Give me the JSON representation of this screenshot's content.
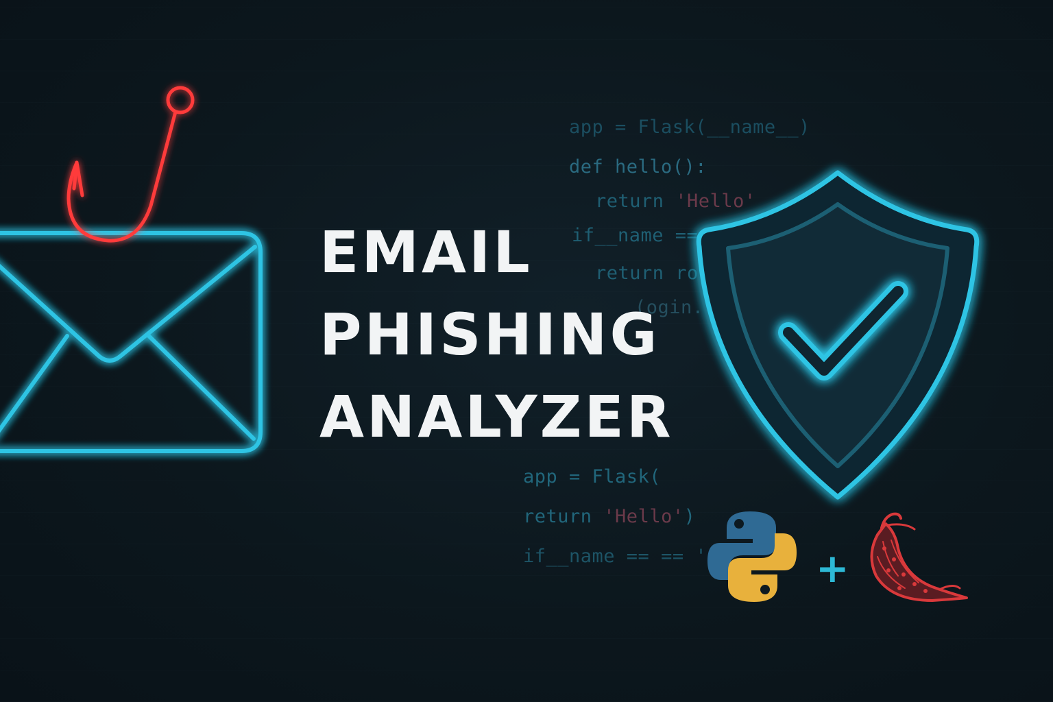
{
  "title": {
    "line1": "EMAIL",
    "line2": "PHISHING",
    "line3": "ANALYZER"
  },
  "code_top": {
    "line1": "app = Flask(__name__)",
    "line2": "def hello():",
    "line3_kw": "return ",
    "line3_str": "'Hello'",
    "line4": "if__name ==",
    "line5": "return ro",
    "line6": "(ogin."
  },
  "code_bottom": {
    "line1": "app = Flask(",
    "line2_kw": "return ",
    "line2_str": "'Hello'",
    "line2_end": ")",
    "line3": "if__name == == '"
  },
  "plus_sign": "+",
  "icons": {
    "envelope": "envelope-icon",
    "hook": "fishing-hook-icon",
    "shield": "shield-check-icon",
    "python": "python-logo-icon",
    "flask": "flask-pepper-logo-icon"
  },
  "colors": {
    "background": "#0d1a21",
    "neon_cyan": "#2fc4e4",
    "neon_red": "#ff3b3b",
    "title": "#f2f4f5",
    "python_blue": "#2f6a94",
    "python_yellow": "#e8b13c",
    "flask_red": "#d9393b"
  }
}
